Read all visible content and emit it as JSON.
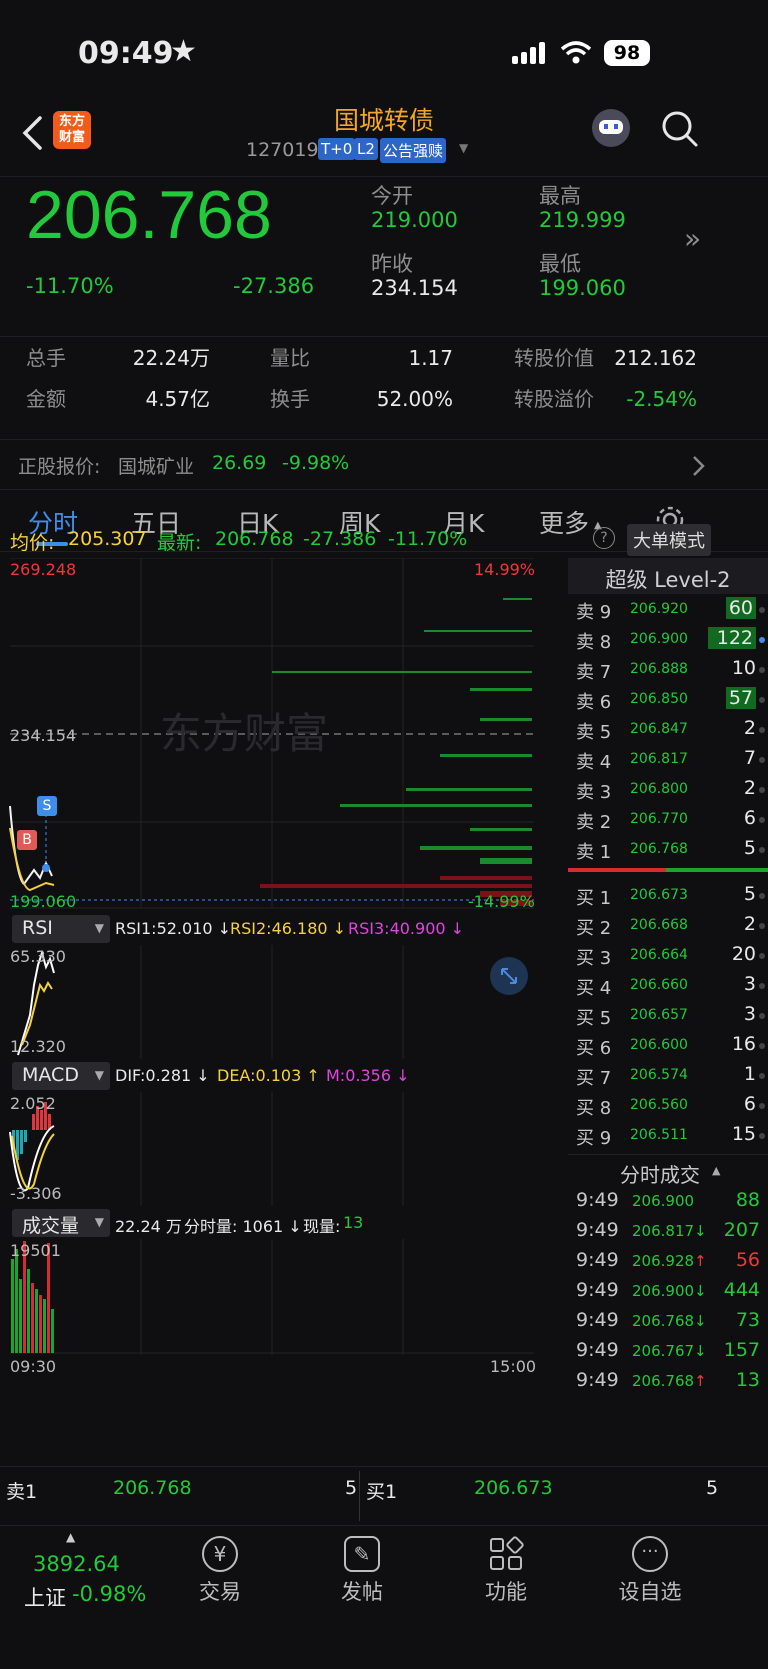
{
  "status_bar": {
    "time": "09:49",
    "battery": "98"
  },
  "header": {
    "logo_line1": "东方",
    "logo_line2": "财富",
    "title": "国城转债",
    "code": "127019",
    "badges": [
      "T+0",
      "L2",
      "公告强赎"
    ]
  },
  "quote": {
    "price": "206.768",
    "change_pct": "-11.70%",
    "change": "-27.386",
    "open_label": "今开",
    "open": "219.000",
    "high_label": "最高",
    "high": "219.999",
    "prev_close_label": "昨收",
    "prev_close": "234.154",
    "low_label": "最低",
    "low": "199.060"
  },
  "stats": {
    "row1": [
      {
        "label": "总手",
        "value": "22.24万"
      },
      {
        "label": "量比",
        "value": "1.17"
      },
      {
        "label": "转股价值",
        "value": "212.162"
      }
    ],
    "row2": [
      {
        "label": "金额",
        "value": "4.57亿"
      },
      {
        "label": "换手",
        "value": "52.00%"
      },
      {
        "label": "转股溢价",
        "value": "-2.54%"
      }
    ]
  },
  "underlying": {
    "label": "正股报价:",
    "name": "国城矿业",
    "price": "26.69",
    "pct": "-9.98%"
  },
  "tabs": [
    "分时",
    "五日",
    "日K",
    "周K",
    "月K",
    "更多"
  ],
  "avg_line": {
    "avg_label": "均价:",
    "avg": "205.307",
    "latest_label": "最新:",
    "latest": "206.768",
    "change": "-27.386",
    "pct": "-11.70%",
    "help": "?",
    "mode_button": "大单模式"
  },
  "main_chart": {
    "ymax": "269.248",
    "ymax_pct": "14.99%",
    "yref": "234.154",
    "ymin": "199.060",
    "ymin_pct": "-14.99%",
    "watermark": "东方财富",
    "marker_s": "S",
    "marker_b": "B"
  },
  "rsi": {
    "selector": "RSI",
    "rsi1": "RSI1:52.010 ↓",
    "rsi2": "RSI2:46.180 ↓",
    "rsi3": "RSI3:40.900 ↓",
    "top": "65.330",
    "bottom": "12.320"
  },
  "macd": {
    "selector": "MACD",
    "dif": "DIF:0.281 ↓",
    "dea": "DEA:0.103 ↑",
    "m": "M:0.356 ↓",
    "top": "2.052",
    "bottom": "-3.306"
  },
  "volume": {
    "selector": "成交量",
    "total": "22.24 万",
    "minute": "分时量: 1061 ↓",
    "now_label": "现量:",
    "now": "13",
    "top": "19501",
    "t_start": "09:30",
    "t_end": "15:00"
  },
  "level2": {
    "title": "超级 Level-2",
    "asks": [
      {
        "label": "卖 9",
        "price": "206.920",
        "qty": "60"
      },
      {
        "label": "卖 8",
        "price": "206.900",
        "qty": "122"
      },
      {
        "label": "卖 7",
        "price": "206.888",
        "qty": "10"
      },
      {
        "label": "卖 6",
        "price": "206.850",
        "qty": "57"
      },
      {
        "label": "卖 5",
        "price": "206.847",
        "qty": "2"
      },
      {
        "label": "卖 4",
        "price": "206.817",
        "qty": "7"
      },
      {
        "label": "卖 3",
        "price": "206.800",
        "qty": "2"
      },
      {
        "label": "卖 2",
        "price": "206.770",
        "qty": "6"
      },
      {
        "label": "卖 1",
        "price": "206.768",
        "qty": "5"
      }
    ],
    "bids": [
      {
        "label": "买 1",
        "price": "206.673",
        "qty": "5"
      },
      {
        "label": "买 2",
        "price": "206.668",
        "qty": "2"
      },
      {
        "label": "买 3",
        "price": "206.664",
        "qty": "20"
      },
      {
        "label": "买 4",
        "price": "206.660",
        "qty": "3"
      },
      {
        "label": "买 5",
        "price": "206.657",
        "qty": "3"
      },
      {
        "label": "买 6",
        "price": "206.600",
        "qty": "16"
      },
      {
        "label": "买 7",
        "price": "206.574",
        "qty": "1"
      },
      {
        "label": "买 8",
        "price": "206.560",
        "qty": "6"
      },
      {
        "label": "买 9",
        "price": "206.511",
        "qty": "15"
      }
    ],
    "trades_title": "分时成交",
    "trades": [
      {
        "time": "9:49",
        "price": "206.900",
        "arrow": "",
        "vol": "88",
        "dir": "up"
      },
      {
        "time": "9:49",
        "price": "206.817",
        "arrow": "↓",
        "vol": "207",
        "dir": "down"
      },
      {
        "time": "9:49",
        "price": "206.928",
        "arrow": "↑",
        "vol": "56",
        "dir": "up"
      },
      {
        "time": "9:49",
        "price": "206.900",
        "arrow": "↓",
        "vol": "444",
        "dir": "down"
      },
      {
        "time": "9:49",
        "price": "206.768",
        "arrow": "↓",
        "vol": "73",
        "dir": "down"
      },
      {
        "time": "9:49",
        "price": "206.767",
        "arrow": "↓",
        "vol": "157",
        "dir": "down"
      },
      {
        "time": "9:49",
        "price": "206.768",
        "arrow": "↑",
        "vol": "13",
        "dir": "up"
      }
    ]
  },
  "best_quote": {
    "ask_label": "卖1",
    "ask_price": "206.768",
    "ask_qty": "5",
    "bid_label": "买1",
    "bid_price": "206.673",
    "bid_qty": "5"
  },
  "bottom_nav": {
    "index_value": "3892.64",
    "index_name": "上证",
    "index_pct": "-0.98%",
    "items": [
      "交易",
      "发帖",
      "功能",
      "设自选"
    ]
  },
  "colors": {
    "up": "#f0373a",
    "down": "#22c93a",
    "accent": "#f5a623",
    "tab_active": "#3d8eea"
  }
}
